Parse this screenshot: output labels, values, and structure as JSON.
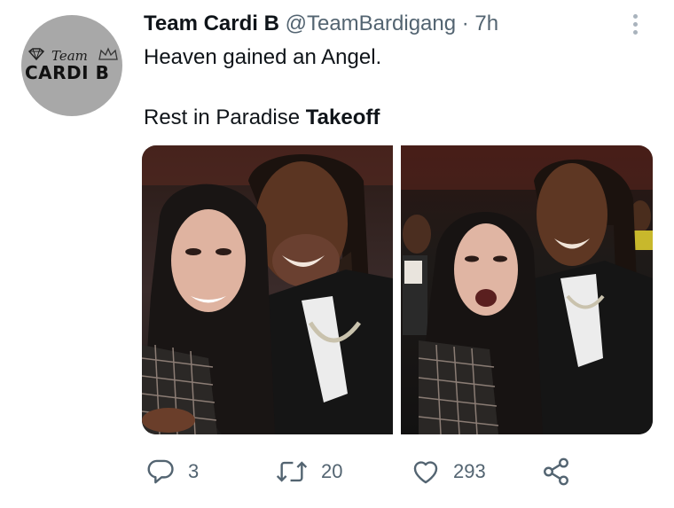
{
  "colors": {
    "text": "#0f1419",
    "secondary": "#536471",
    "avatar_bg": "#a8a8a8"
  },
  "avatar": {
    "team": "Team",
    "cardi": "CARDI B"
  },
  "tweet": {
    "display_name": "Team Cardi B",
    "handle": "@TeamBardigang",
    "separator": "·",
    "time": "7h",
    "line1": "Heaven gained an Angel.",
    "line2_prefix": "Rest in Paradise ",
    "line2_bold": "Takeoff"
  },
  "actions": {
    "reply_count": "3",
    "retweet_count": "20",
    "like_count": "293"
  },
  "icons": [
    "more-options-icon",
    "reply-icon",
    "retweet-icon",
    "like-icon",
    "share-icon"
  ]
}
